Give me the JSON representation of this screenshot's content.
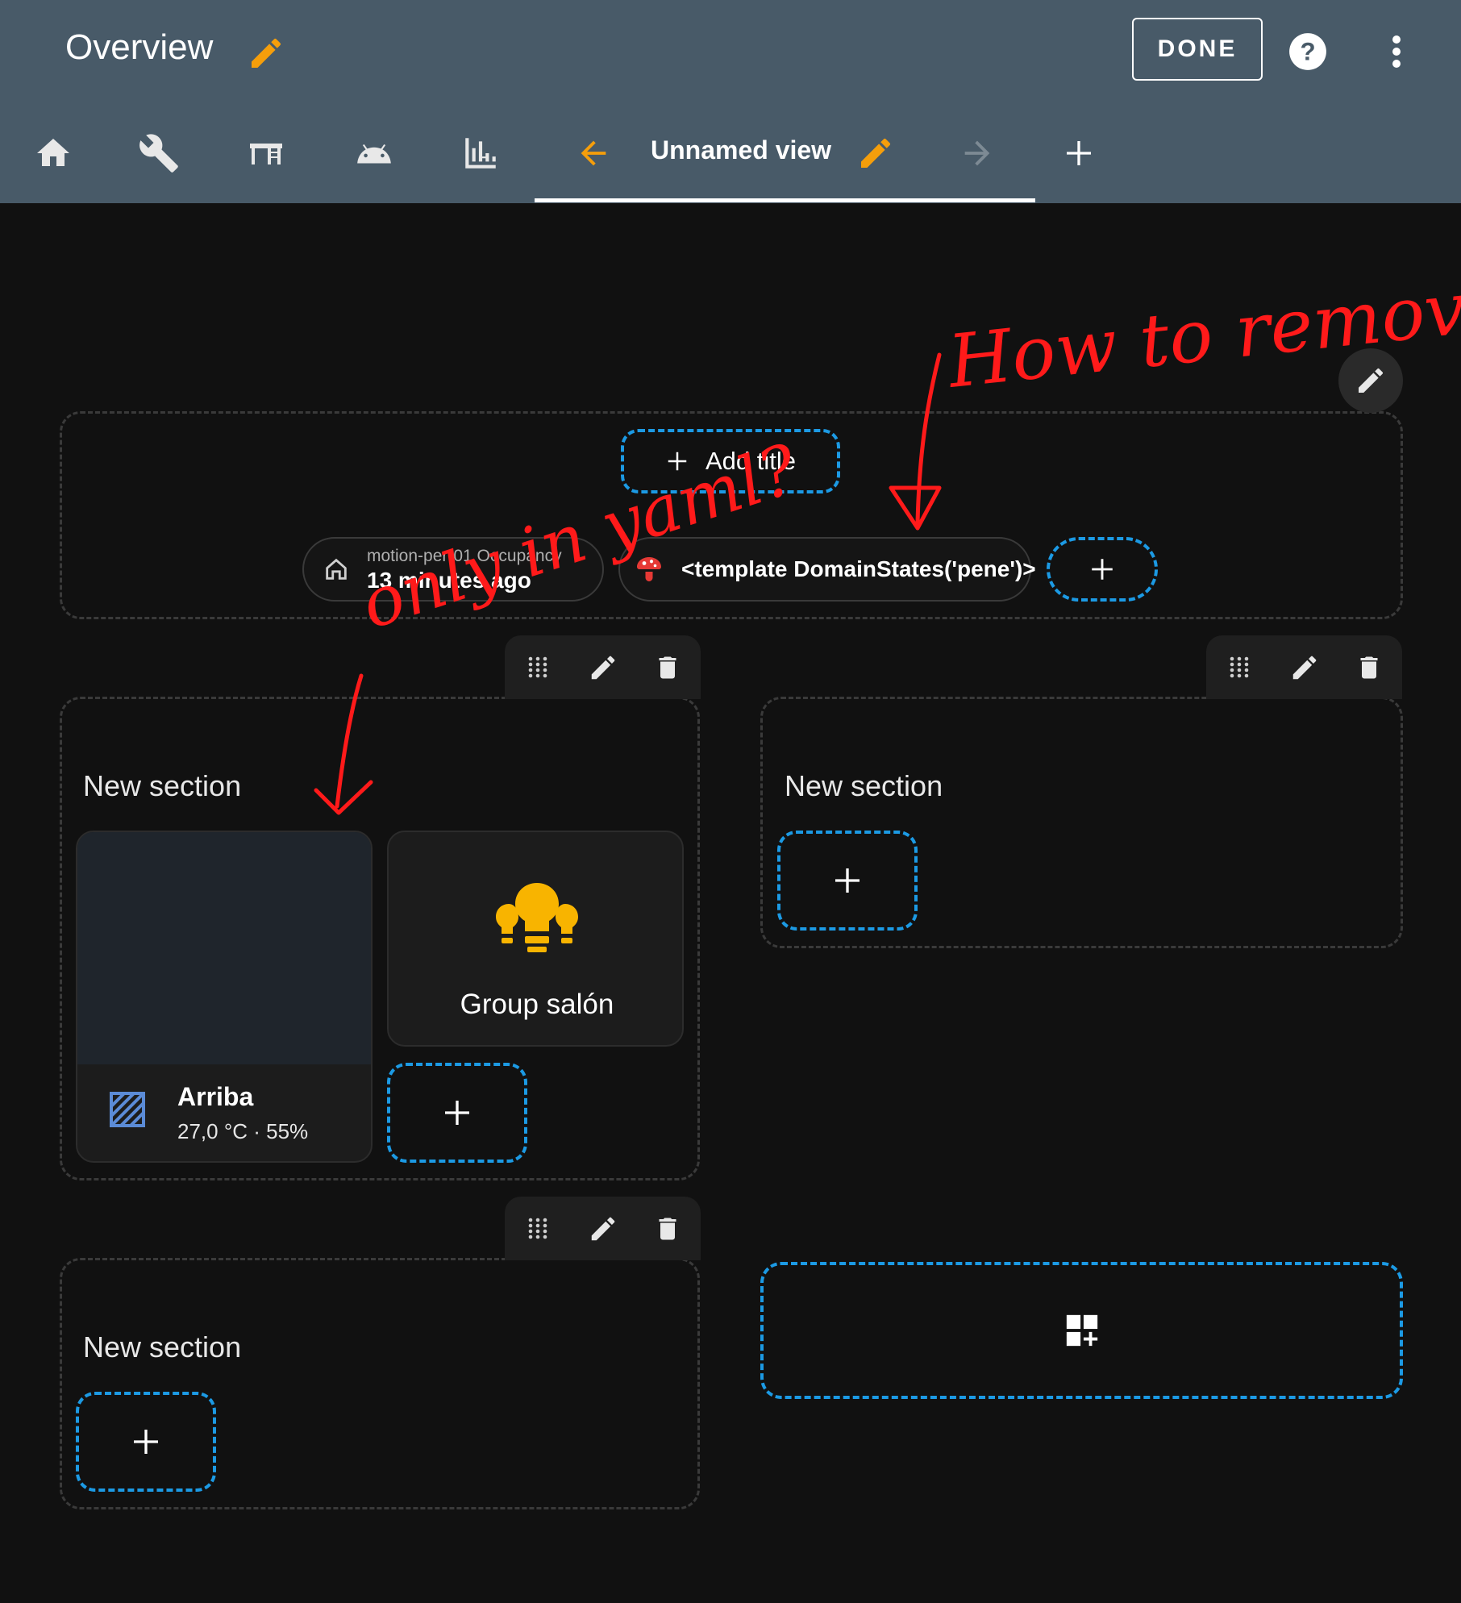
{
  "header": {
    "title": "Overview",
    "done_label": "DONE",
    "tabs": [
      {
        "icon": "home-icon"
      },
      {
        "icon": "wrench-icon"
      },
      {
        "icon": "desk-icon"
      },
      {
        "icon": "android-icon"
      },
      {
        "icon": "chart-icon"
      }
    ],
    "active_tab": {
      "label": "Unnamed view"
    }
  },
  "badges_area": {
    "add_title_label": "Add title",
    "badges": [
      {
        "name": "motion-per-01 Occupancy",
        "state": "13 minutes ago",
        "icon": "home-outline-icon"
      },
      {
        "name": "<template DomainStates('pene')>",
        "icon": "mushroom-icon"
      }
    ]
  },
  "sections": [
    {
      "title": "New section",
      "cards": [
        {
          "name": "Arriba",
          "state": "27,0 °C · 55%",
          "icon": "thermostat-hatched-icon"
        },
        {
          "name": "Group salón",
          "icon": "lightbulb-group-icon"
        }
      ]
    },
    {
      "title": "New section"
    },
    {
      "title": "New section"
    }
  ],
  "annotations": {
    "top_text": "How to remove",
    "left_text": "only in yaml?"
  },
  "colors": {
    "header_bg": "#485a68",
    "accent_orange": "#f59e0b",
    "dashed_blue": "#1c9ae4",
    "annotation_red": "#ff1a1a",
    "bulb_yellow": "#f8b400"
  }
}
